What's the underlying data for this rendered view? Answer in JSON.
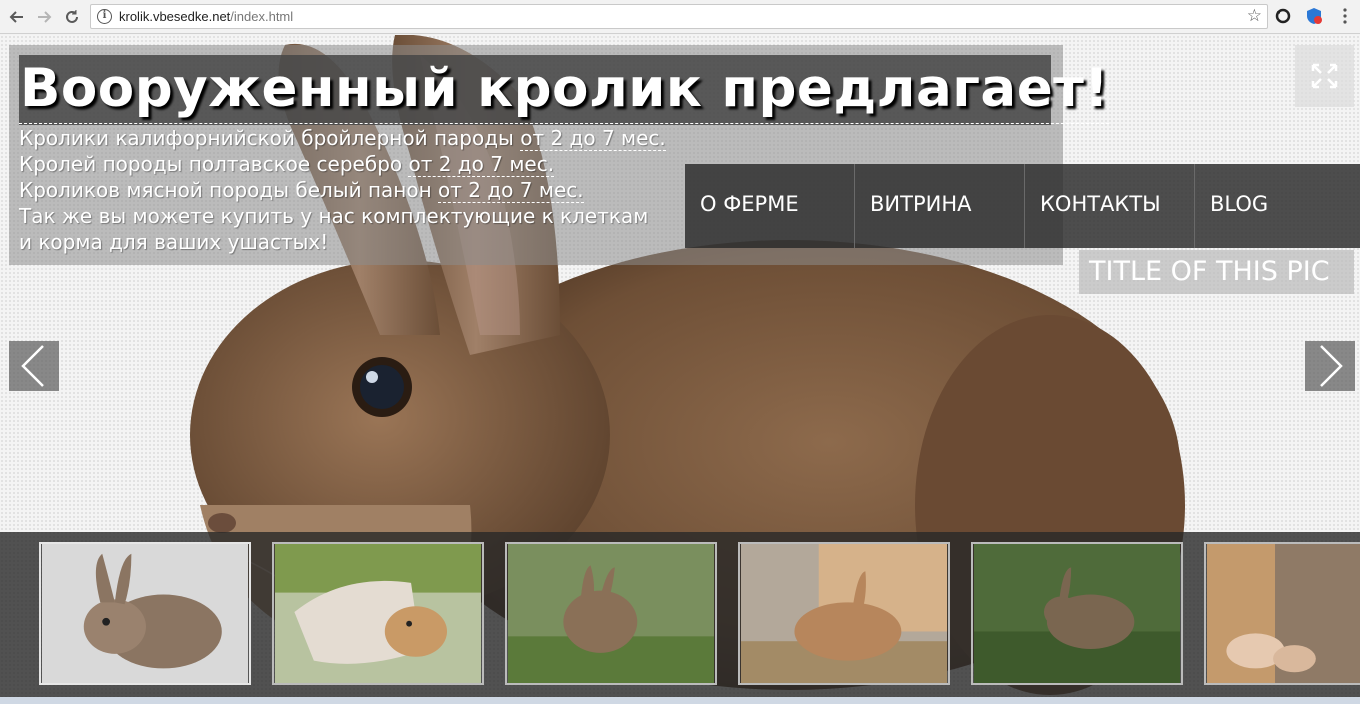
{
  "browser": {
    "url_host": "krolik.vbesedke.net",
    "url_path": "/index.html"
  },
  "page": {
    "headline": "Вооруженный кролик предлагает!",
    "offers": [
      {
        "text": "Кролики калифорнийской бройлерной пароды ",
        "link": "от 2 до 7 мес."
      },
      {
        "text": "Кролей породы полтавское серебро ",
        "link": "от 2 до 7 мес."
      },
      {
        "text": "Кроликов мясной породы белый панон ",
        "link": "от 2 до 7 мес."
      }
    ],
    "extra_line_1": "Так же вы можете купить у нас комплектующие к клеткам",
    "extra_line_2": "и корма для ваших ушастых!",
    "menu": {
      "items": [
        "О ФЕРМЕ",
        "ВИТРИНА",
        "КОНТАКТЫ",
        "BLOG"
      ]
    },
    "pic_title": "TITLE OF THIS PIC"
  },
  "colors": {
    "rabbit_fur": "#8a6547",
    "menu_bg": "#2c2c2c",
    "thumb_strip_bg": "#333333"
  }
}
